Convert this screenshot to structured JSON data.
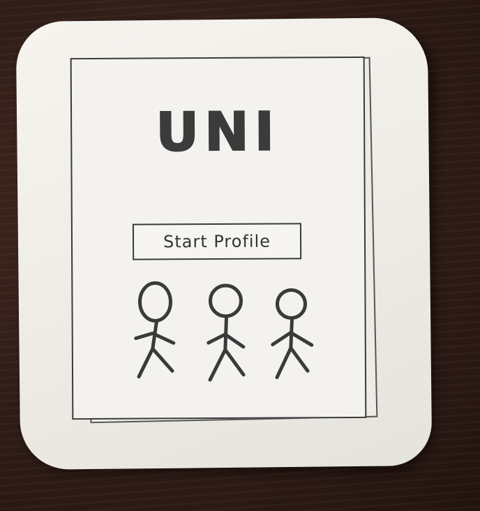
{
  "app": {
    "logo_text": "UNI"
  },
  "actions": {
    "start_profile_label": "Start Profile"
  },
  "illustration": {
    "icon": "people-group-icon",
    "figure_count": 3
  },
  "colors": {
    "ink": "#3a3a3a",
    "paper": "#f3f2ee",
    "table": "#35201a"
  }
}
